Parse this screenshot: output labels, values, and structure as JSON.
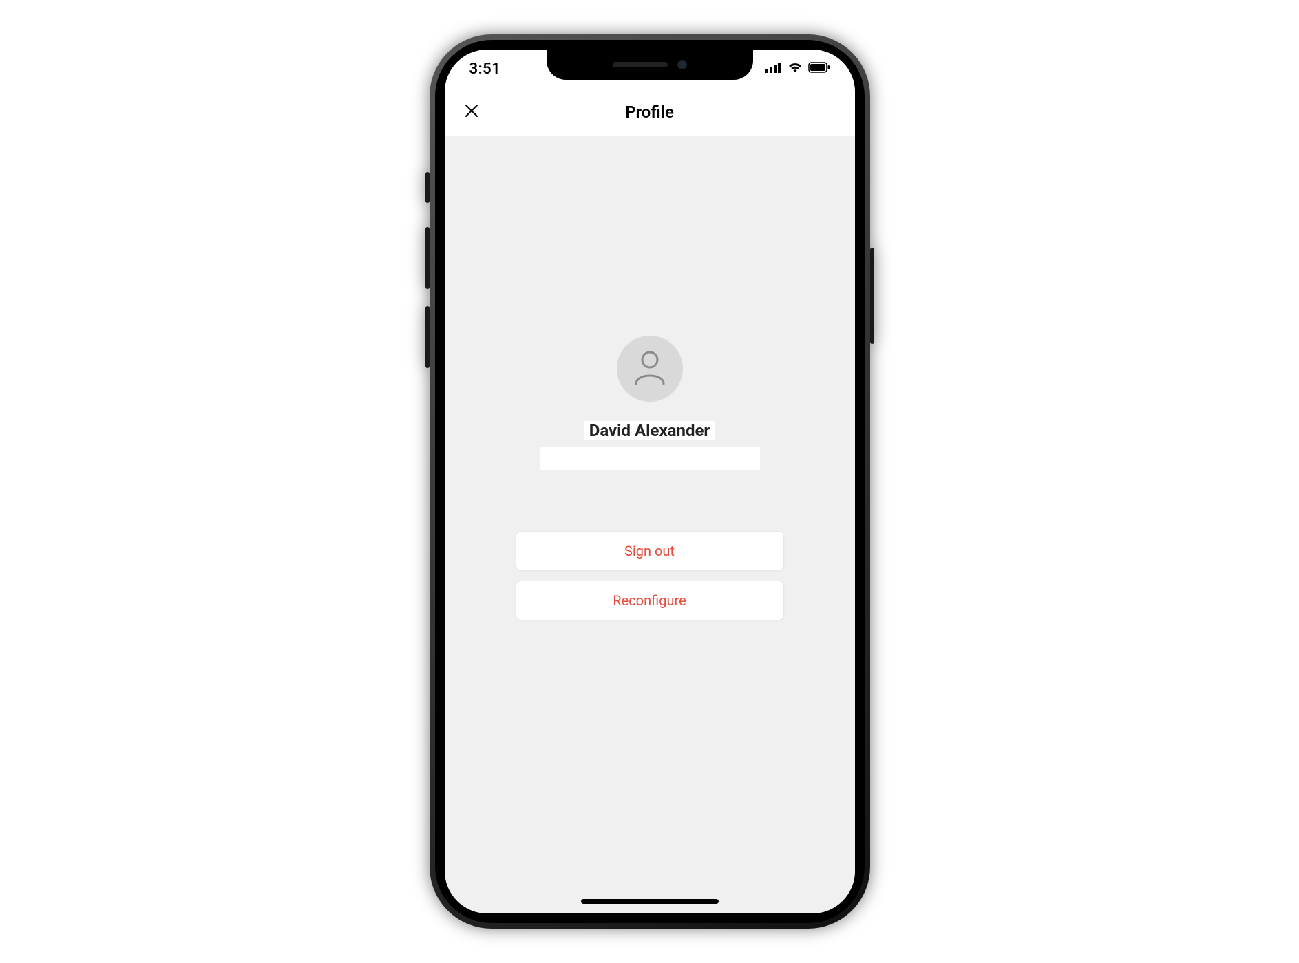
{
  "status_bar": {
    "time": "3:51"
  },
  "header": {
    "title": "Profile"
  },
  "profile": {
    "name": "David Alexander"
  },
  "actions": {
    "sign_out": "Sign out",
    "reconfigure": "Reconfigure"
  },
  "colors": {
    "danger": "#e74c3c",
    "content_bg": "#f0f0f0"
  }
}
